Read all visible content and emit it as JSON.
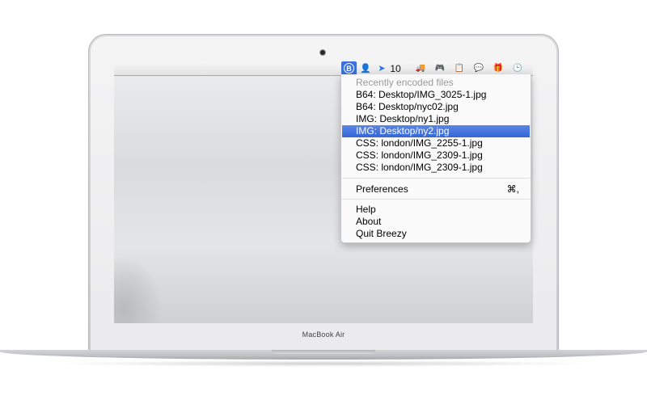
{
  "device": {
    "brand_label": "MacBook Air"
  },
  "menubar": {
    "items": [
      {
        "icon": "breezy-b-icon",
        "glyph": "B",
        "active": true
      },
      {
        "icon": "person-icon",
        "glyph": "👤"
      },
      {
        "icon": "cursor-arrow-icon",
        "glyph": "➤",
        "count": "10"
      },
      {
        "icon": "truck-icon",
        "glyph": "🚚"
      },
      {
        "icon": "gamepad-icon",
        "glyph": "🎮"
      },
      {
        "icon": "clipboard-icon",
        "glyph": "📋"
      },
      {
        "icon": "speech-bubble-icon",
        "glyph": "💬"
      },
      {
        "icon": "gift-icon",
        "glyph": "🎁"
      },
      {
        "icon": "clock-icon",
        "glyph": "🕒"
      }
    ]
  },
  "menu": {
    "header": "Recently encoded files",
    "recent": [
      "B64: Desktop/IMG_3025-1.jpg",
      "B64: Desktop/nyc02.jpg",
      "IMG: Desktop/ny1.jpg",
      "IMG: Desktop/ny2.jpg",
      "CSS: london/IMG_2255-1.jpg",
      "CSS: london/IMG_2309-1.jpg",
      "CSS: london/IMG_2309-1.jpg"
    ],
    "selected_index": 3,
    "preferences": {
      "label": "Preferences",
      "shortcut": "⌘,"
    },
    "footer": [
      "Help",
      "About",
      "Quit Breezy"
    ]
  },
  "colors": {
    "selection": "#3466d6",
    "menubar_active": "#3f6fd8"
  }
}
